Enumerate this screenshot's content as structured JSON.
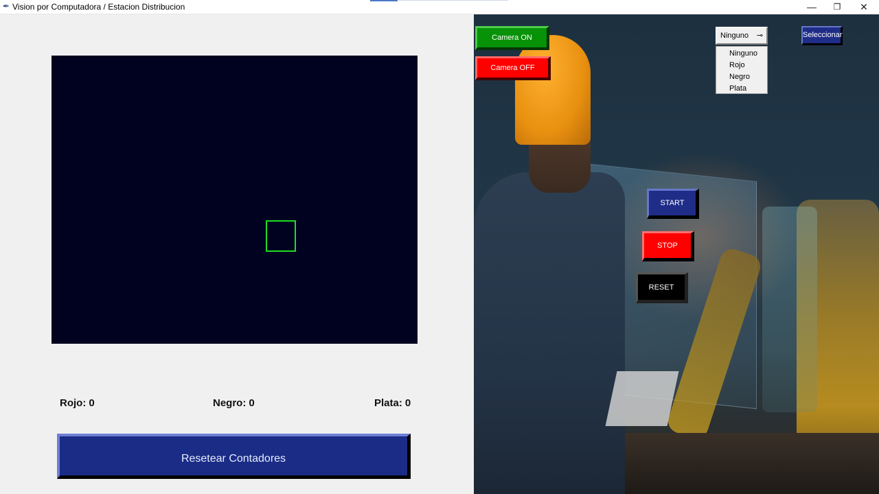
{
  "window": {
    "title": "Vision por Computadora / Estacion Distribucion",
    "app_icon": "feather-icon",
    "minimize_label": "—",
    "maximize_label": "❐",
    "close_label": "✕"
  },
  "counters": {
    "rojo_label": "Rojo:",
    "rojo_value": "0",
    "negro_label": "Negro:",
    "negro_value": "0",
    "plata_label": "Plata:",
    "plata_value": "0"
  },
  "reset_counters_label": "Resetear Contadores",
  "camera": {
    "on_label": "Camera ON",
    "off_label": "Camera OFF"
  },
  "controls": {
    "start_label": "START",
    "stop_label": "STOP",
    "reset_label": "RESET"
  },
  "color_select": {
    "selected": "Ninguno",
    "options": [
      "Ninguno",
      "Rojo",
      "Negro",
      "Plata"
    ],
    "button_label": "Seleccionar"
  },
  "colors": {
    "camera_bg": "#01021f",
    "detect_box": "#22dd22",
    "navy_button": "#1f2d88",
    "green_button": "#079207",
    "red_button": "#ff0000"
  }
}
